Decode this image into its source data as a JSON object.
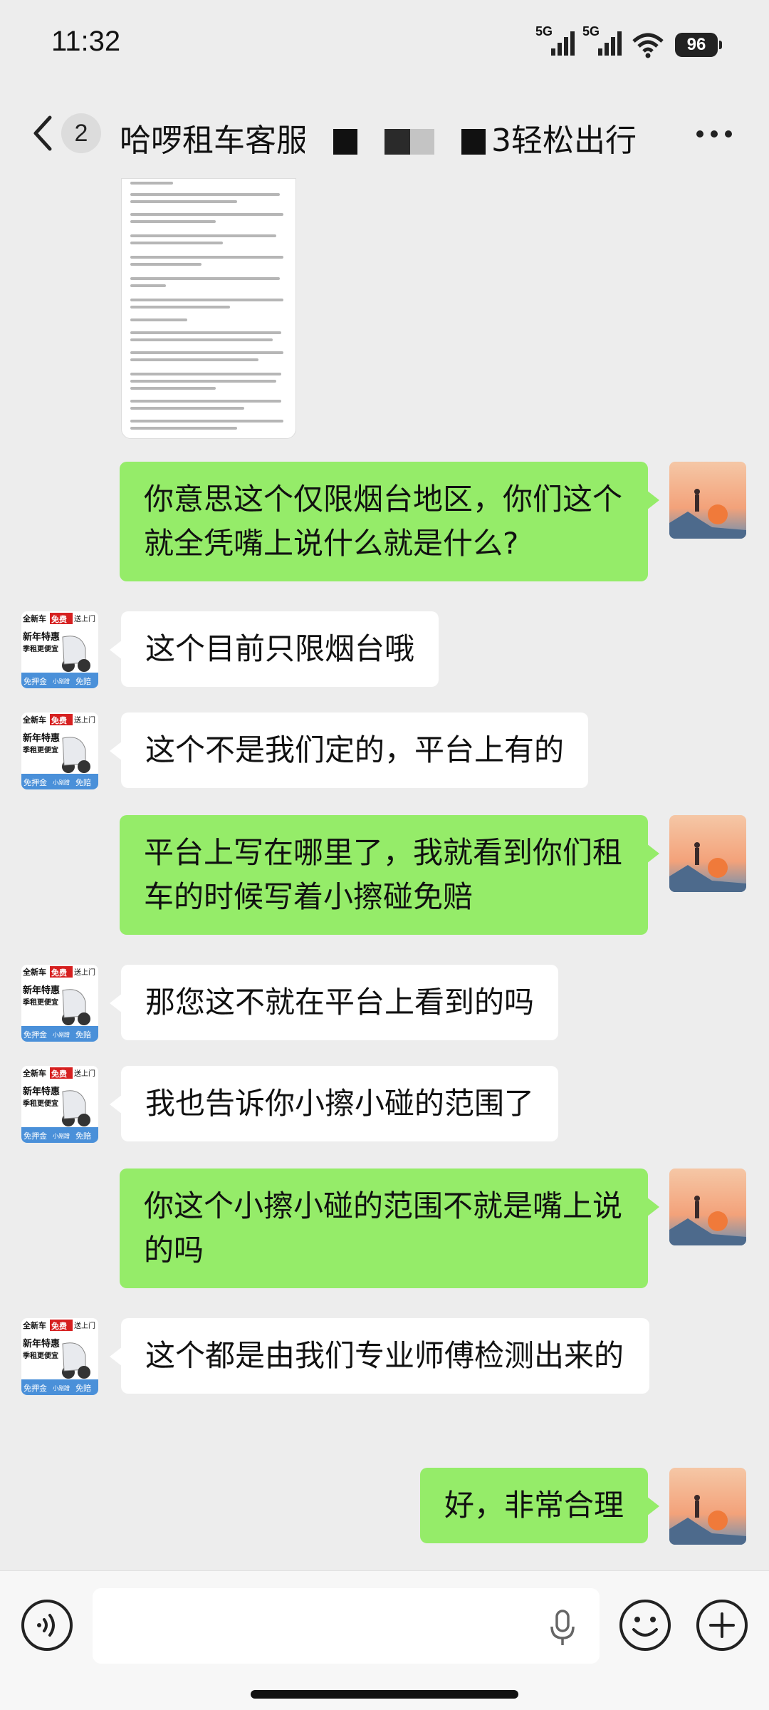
{
  "status_bar": {
    "time": "11:32",
    "signal1_label": "5G",
    "signal2_label": "5G",
    "battery": "96"
  },
  "header": {
    "unread_count": "2",
    "title_left": "哈啰租车客服",
    "title_right": "3轻松出行"
  },
  "messages": [
    {
      "from": "me",
      "text": "你意思这个仅限烟台地区，你们这个就全凭嘴上说什么就是什么?"
    },
    {
      "from": "them",
      "text": "这个目前只限烟台哦"
    },
    {
      "from": "them",
      "text": "这个不是我们定的，平台上有的"
    },
    {
      "from": "me",
      "text": "平台上写在哪里了，我就看到你们租车的时候写着小擦碰免赔"
    },
    {
      "from": "them",
      "text": "那您这不就在平台上看到的吗"
    },
    {
      "from": "them",
      "text": "我也告诉你小擦小碰的范围了"
    },
    {
      "from": "me",
      "text": "你这个小擦小碰的范围不就是嘴上说的吗"
    },
    {
      "from": "them",
      "text": "这个都是由我们专业师傅检测出来的"
    },
    {
      "from": "me",
      "text": "好，非常合理"
    }
  ],
  "service_avatar": {
    "line1_left": "全新车",
    "line1_badge": "免费",
    "line1_right": "送上门",
    "line2": "新年特惠",
    "line3": "季租更便宜",
    "line4_left": "免押金",
    "line4_mid": "小剐蹭",
    "line4_right": "免赔"
  },
  "colors": {
    "my_bubble": "#95ec69",
    "their_bubble": "#ffffff",
    "background": "#ededed"
  }
}
